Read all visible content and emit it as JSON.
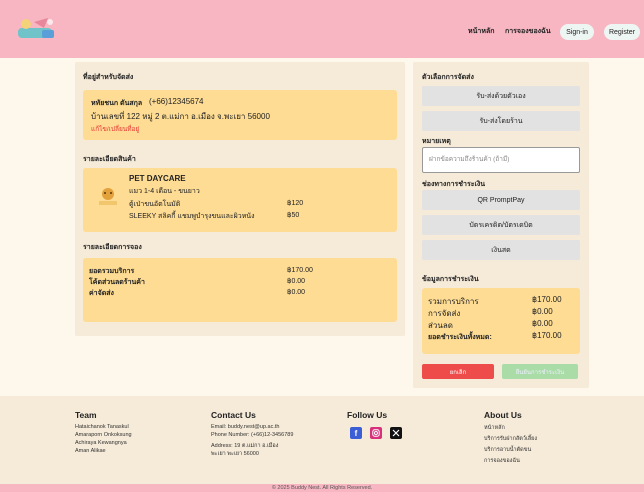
{
  "header": {
    "nav": [
      "หน้าหลัก",
      "การจองของฉัน"
    ],
    "signin": "Sign-in",
    "register": "Register"
  },
  "shipping_address": {
    "title": "ที่อยู่สำหรับจัดส่ง",
    "name": "หทัยชนก ตันสกุล",
    "phone": "(+66)12345674",
    "address": "บ้านเลขที่ 122 หมู่ 2 ต.แม่กา อ.เมือง จ.พะเยา 56000",
    "edit_link": "แก้ไข/เปลี่ยนที่อยู่"
  },
  "product_details": {
    "title": "รายละเอียดสินค้า",
    "shop_name": "PET DAYCARE",
    "package": "แมว 1-4 เดือน - ขนยาว",
    "items": [
      {
        "name": "ตู้เป่าขนอัตโนมัติ",
        "price": "฿120"
      },
      {
        "name": "SLEEKY สลิคกี้ แชมพูบำรุงขนและผิวหนัง",
        "price": "฿50"
      }
    ]
  },
  "booking_details": {
    "title": "รายละเอียดการจอง",
    "rows": [
      {
        "label": "ยอดรวมบริการ",
        "value": "฿170.00"
      },
      {
        "label": "โค้ดส่วนลดร้านค้า",
        "value": "฿0.00"
      },
      {
        "label": "ค่าจัดส่ง",
        "value": "฿0.00"
      }
    ]
  },
  "shipping_options": {
    "title": "ตัวเลือกการจัดส่ง",
    "options": [
      "รับ-ส่งด้วยตัวเอง",
      "รับ-ส่งโดยร้าน"
    ]
  },
  "note": {
    "title": "หมายเหตุ",
    "placeholder": "ฝากข้อความถึงร้านค้า (ถ้ามี)"
  },
  "payment_methods": {
    "title": "ช่องทางการชำระเงิน",
    "options": [
      "QR PromptPay",
      "บัตรเครดิต/บัตรเดบิต",
      "เงินสด"
    ]
  },
  "payment_info": {
    "title": "ข้อมูลการชำระเงิน",
    "rows": [
      {
        "label": "รวมการบริการ",
        "value": "฿170.00"
      },
      {
        "label": "การจัดส่ง",
        "value": "฿0.00"
      },
      {
        "label": "ส่วนลด",
        "value": "฿0.00"
      },
      {
        "label": "ยอดชำระเงินทั้งหมด:",
        "value": "฿170.00"
      }
    ]
  },
  "actions": {
    "cancel": "ยกเลิก",
    "confirm": "ยืนยันการชำระเงิน"
  },
  "footer": {
    "team_title": "Team",
    "team": [
      "Hataichanok Tanaskul",
      "Amaraporn Onkoksung",
      "Achiraya Kewangnya",
      "Aman Alikae"
    ],
    "contact_title": "Contact Us",
    "contact": [
      "Email: buddy.nest@up.ac.th",
      "Phone Number: (+66)12-3456789",
      "Address: 19 ต.แม่กา อ.เมือง",
      "พะเยา พะเยา 56000"
    ],
    "follow_title": "Follow Us",
    "about_title": "About Us",
    "about": [
      "หน้าหลัก",
      "บริการรับฝากสัตว์เลี้ยง",
      "บริการอาบน้ำตัดขน",
      "การจองของฉัน"
    ],
    "copyright": "© 2025 Buddy Nest. All Rights Reserved."
  }
}
